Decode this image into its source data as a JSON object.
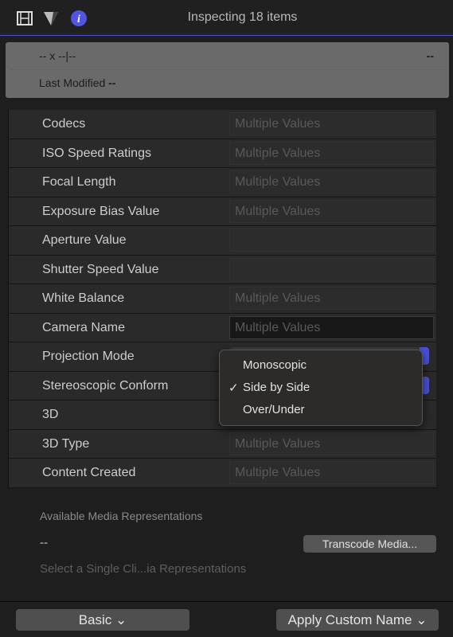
{
  "header": {
    "title": "Inspecting 18 items",
    "icons": [
      "film-icon",
      "color-triangle-icon",
      "info-icon"
    ],
    "accent": "#4a50d8"
  },
  "summary": {
    "dimensions": "-- x --|--",
    "right_value": "--",
    "last_modified_label": "Last Modified",
    "last_modified_value": "--"
  },
  "rows": [
    {
      "label": "Codecs",
      "value": "Multiple Values"
    },
    {
      "label": "ISO Speed Ratings",
      "value": "Multiple Values"
    },
    {
      "label": "Focal Length",
      "value": "Multiple Values"
    },
    {
      "label": "Exposure Bias Value",
      "value": "Multiple Values"
    },
    {
      "label": "Aperture Value",
      "value": ""
    },
    {
      "label": "Shutter Speed Value",
      "value": ""
    },
    {
      "label": "White Balance",
      "value": "Multiple Values"
    },
    {
      "label": "Camera Name",
      "value": "Multiple Values"
    },
    {
      "label": "Projection Mode",
      "value": ""
    },
    {
      "label": "Stereoscopic Conform",
      "value": ""
    },
    {
      "label": "3D",
      "value": ""
    },
    {
      "label": "3D Type",
      "value": "Multiple Values"
    },
    {
      "label": "Content Created",
      "value": "Multiple Values"
    }
  ],
  "menu": {
    "items": [
      "Monoscopic",
      "Side by Side",
      "Over/Under"
    ],
    "selected": "Side by Side",
    "check": "✓"
  },
  "media": {
    "section_label": "Available Media Representations",
    "value": "--",
    "transcode_button": "Transcode Media...",
    "hint": "Select a Single Cli...ia Representations"
  },
  "footer": {
    "basic_button": "Basic",
    "apply_button": "Apply Custom Name",
    "chevron": "⌄"
  }
}
